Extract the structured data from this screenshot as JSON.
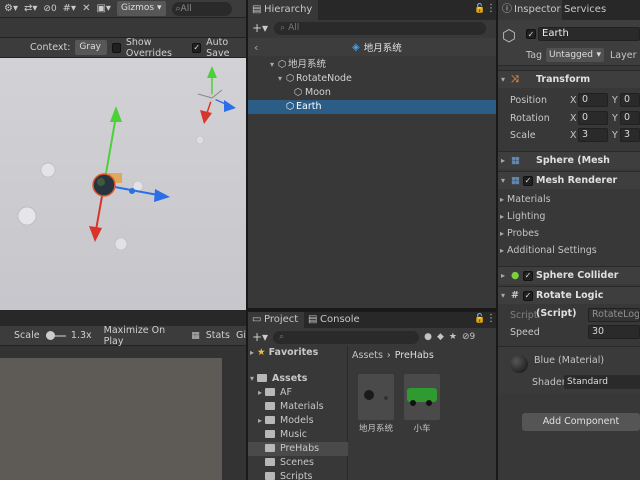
{
  "scene": {
    "toolbar": {
      "gizmos_label": "Gizmos",
      "search_placeholder": "All",
      "layers_count": "0"
    },
    "toolbar2": {
      "context_label": "Context:",
      "context_value": "Gray",
      "show_overrides": "Show Overrides",
      "auto_save": "Auto Save"
    }
  },
  "game": {
    "scale_label": "Scale",
    "scale_value": "1.3x",
    "maximize_label": "Maximize On Play",
    "stats_label": "Stats",
    "gizmos_short": "Gi"
  },
  "hierarchy": {
    "tab_label": "Hierarchy",
    "search_placeholder": "All",
    "scene_name": "地月系统",
    "items": [
      {
        "label": "地月系统"
      },
      {
        "label": "RotateNode"
      },
      {
        "label": "Moon"
      },
      {
        "label": "Earth"
      }
    ]
  },
  "project": {
    "tab_project": "Project",
    "tab_console": "Console",
    "hidden_count": "9",
    "favorites": "Favorites",
    "breadcrumb": {
      "root": "Assets",
      "current": "PreHabs"
    },
    "folders": [
      {
        "label": "Assets"
      },
      {
        "label": "AF"
      },
      {
        "label": "Materials"
      },
      {
        "label": "Models"
      },
      {
        "label": "Music"
      },
      {
        "label": "PreHabs"
      },
      {
        "label": "Scenes"
      },
      {
        "label": "Scripts"
      }
    ],
    "assets": [
      {
        "label": "地月系统"
      },
      {
        "label": "小车"
      }
    ]
  },
  "inspector": {
    "tab_inspector": "Inspector",
    "tab_services": "Services",
    "object_name": "Earth",
    "tag_label": "Tag",
    "tag_value": "Untagged",
    "layer_label": "Layer",
    "transform": {
      "title": "Transform",
      "position_label": "Position",
      "rotation_label": "Rotation",
      "scale_label": "Scale",
      "position": {
        "x": "0",
        "y": "0"
      },
      "rotation": {
        "x": "0",
        "y": "0"
      },
      "scale": {
        "x": "3",
        "y": "3"
      }
    },
    "mesh_filter": "Sphere (Mesh Filter)",
    "mesh_renderer": {
      "title": "Mesh Renderer",
      "sections": [
        "Materials",
        "Lighting",
        "Probes",
        "Additional Settings"
      ]
    },
    "sphere_collider": "Sphere Collider",
    "rotate_logic": {
      "title": "Rotate Logic (Script)",
      "script_label": "Script",
      "script_value": "RotateLogic",
      "speed_label": "Speed",
      "speed_value": "30"
    },
    "material": {
      "name": "Blue (Material)",
      "shader_label": "Shader",
      "shader_value": "Standard"
    },
    "add_component": "Add Component"
  },
  "colors": {
    "selection": "#2c5d87",
    "axis_x": "#d9342b",
    "axis_y": "#4cd03a",
    "axis_z": "#2a6fe8"
  }
}
